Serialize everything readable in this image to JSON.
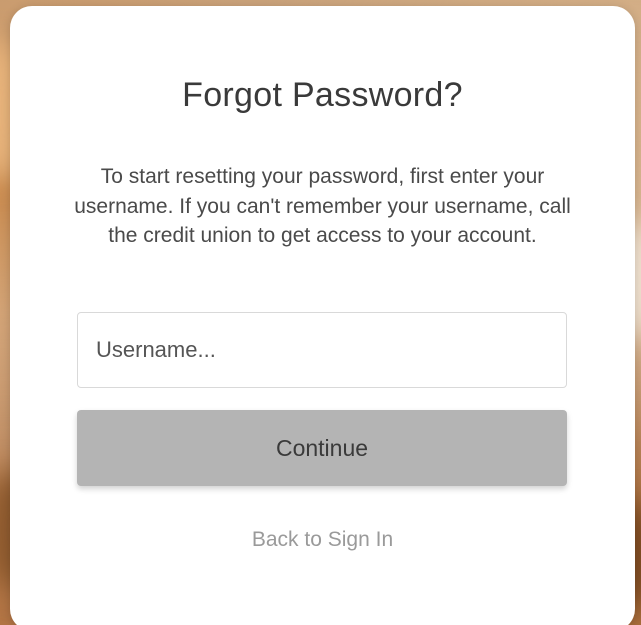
{
  "dialog": {
    "title": "Forgot Password?",
    "description": "To start resetting your password, first enter your username. If you can't remember your username, call the credit union to get access to your account.",
    "username_input": {
      "value": "",
      "placeholder": "Username..."
    },
    "continue_label": "Continue",
    "back_link_label": "Back to Sign In"
  },
  "colors": {
    "card_background": "#ffffff",
    "button_disabled": "#b4b4b4",
    "link_text": "#9a9a9a",
    "title_text": "#3a3a3a"
  }
}
